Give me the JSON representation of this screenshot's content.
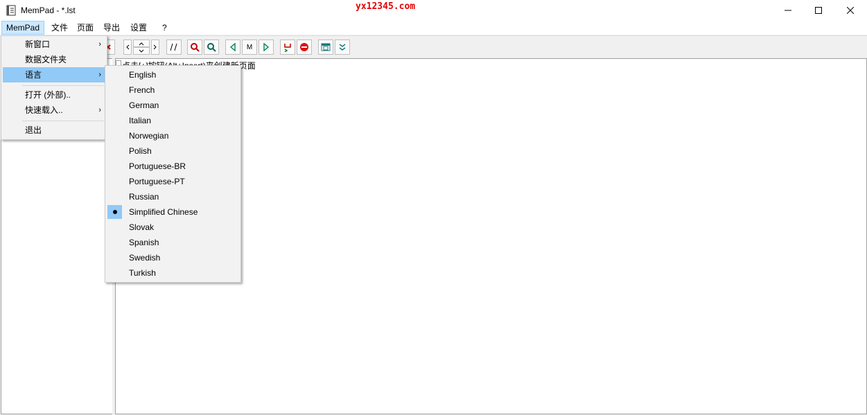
{
  "window": {
    "title": "MemPad - *.lst",
    "watermark": "yx12345.com"
  },
  "menubar": {
    "items": [
      "MemPad",
      "文件",
      "页面",
      "导出",
      "设置",
      "?"
    ]
  },
  "toolbar": {
    "nav_m_label": "M"
  },
  "main": {
    "hint": "点击[+]按钮(Alt+Insert)来创建新页面"
  },
  "mempad_menu": {
    "new_window": "新窗口",
    "data_folder": "数据文件夹",
    "language": "语言",
    "open_external": "打开 (外部)..",
    "quick_load": "快速载入..",
    "exit": "退出"
  },
  "language_menu": {
    "items": [
      "English",
      "French",
      "German",
      "Italian",
      "Norwegian",
      "Polish",
      "Portuguese-BR",
      "Portuguese-PT",
      "Russian",
      "Simplified Chinese",
      "Slovak",
      "Spanish",
      "Swedish",
      "Turkish"
    ],
    "selected": "Simplified Chinese"
  },
  "colors": {
    "highlight": "#91c9f7",
    "menu_active": "#cce8ff",
    "watermark": "#e60000"
  }
}
